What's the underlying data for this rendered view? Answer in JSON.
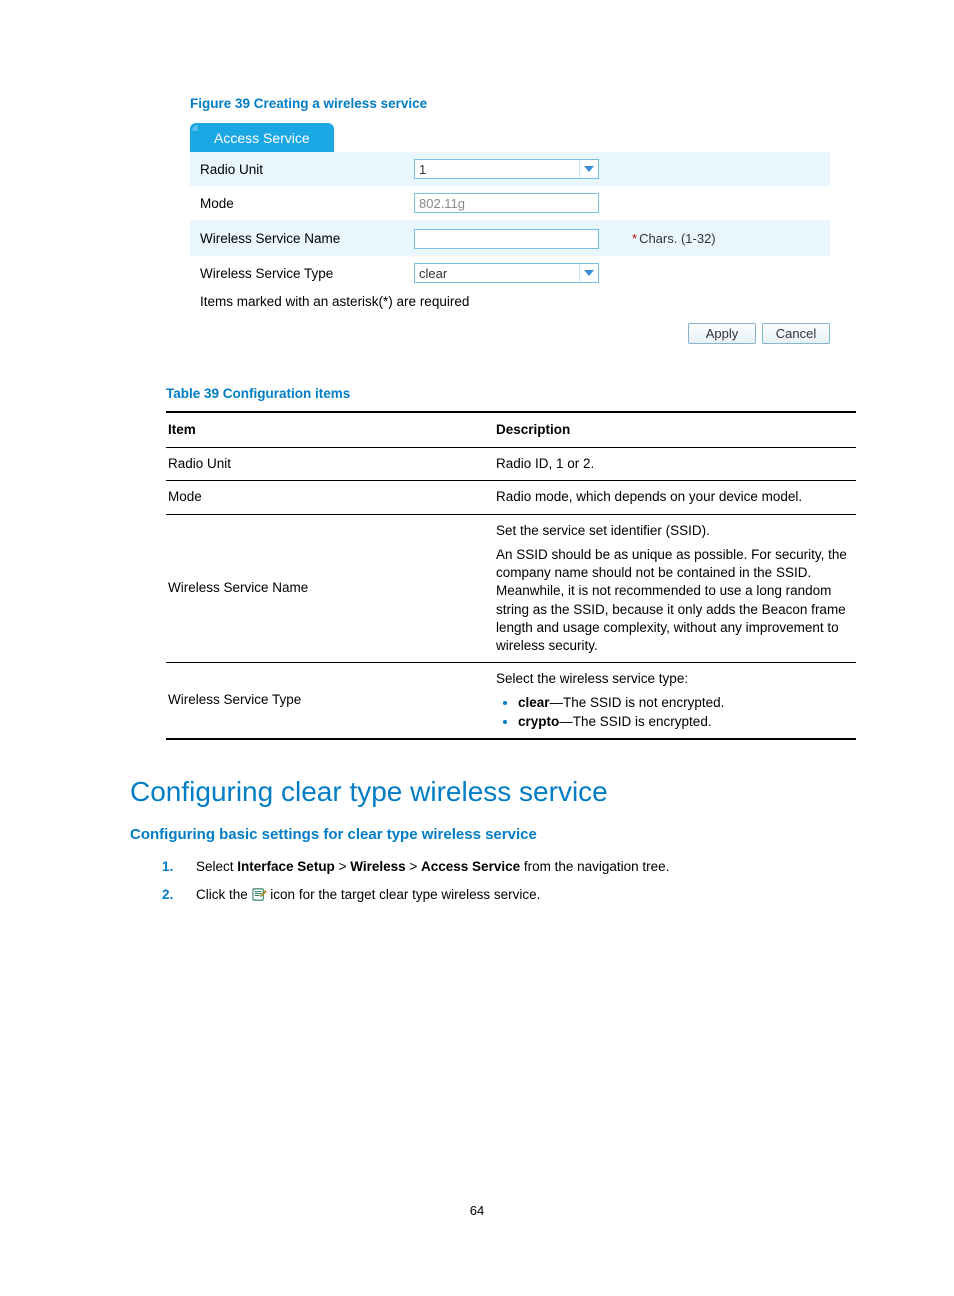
{
  "figure": {
    "caption": "Figure 39 Creating a wireless service"
  },
  "tab": {
    "label": "Access Service"
  },
  "form": {
    "rows": {
      "radio_unit": {
        "label": "Radio Unit",
        "value": "1"
      },
      "mode": {
        "label": "Mode",
        "value": "802.11g"
      },
      "service_name": {
        "label": "Wireless Service Name",
        "value": "",
        "hint": "Chars. (1-32)",
        "asterisk": "*"
      },
      "service_type": {
        "label": "Wireless Service Type",
        "value": "clear"
      }
    },
    "note": "Items marked with an asterisk(*) are required"
  },
  "buttons": {
    "apply": "Apply",
    "cancel": "Cancel"
  },
  "table": {
    "caption": "Table 39 Configuration items",
    "head": {
      "item": "Item",
      "desc": "Description"
    },
    "rows": {
      "radio_unit": {
        "item": "Radio Unit",
        "desc": "Radio ID, 1 or 2."
      },
      "mode": {
        "item": "Mode",
        "desc": "Radio mode, which depends on your device model."
      },
      "service_name": {
        "item": "Wireless Service Name",
        "p1": "Set the service set identifier (SSID).",
        "p2": "An SSID should be as unique as possible. For security, the company name should not be contained in the SSID. Meanwhile, it is not recommended to use a long random string as the SSID, because it only adds the Beacon frame length and usage complexity, without any improvement to wireless security."
      },
      "service_type": {
        "item": "Wireless Service Type",
        "intro": "Select the wireless service type:",
        "bullet1_b": "clear",
        "bullet1_t": "—The SSID is not encrypted.",
        "bullet2_b": "crypto",
        "bullet2_t": "—The SSID is encrypted."
      }
    }
  },
  "heading": "Configuring clear type wireless service",
  "subheading": "Configuring basic settings for clear type wireless service",
  "steps": {
    "s1_a": "Select ",
    "s1_b1": "Interface Setup",
    "s1_g1": " > ",
    "s1_b2": "Wireless",
    "s1_g2": " > ",
    "s1_b3": "Access Service",
    "s1_c": " from the navigation tree.",
    "s2_a": "Click the ",
    "s2_b": " icon for the target clear type wireless service."
  },
  "page_number": "64"
}
